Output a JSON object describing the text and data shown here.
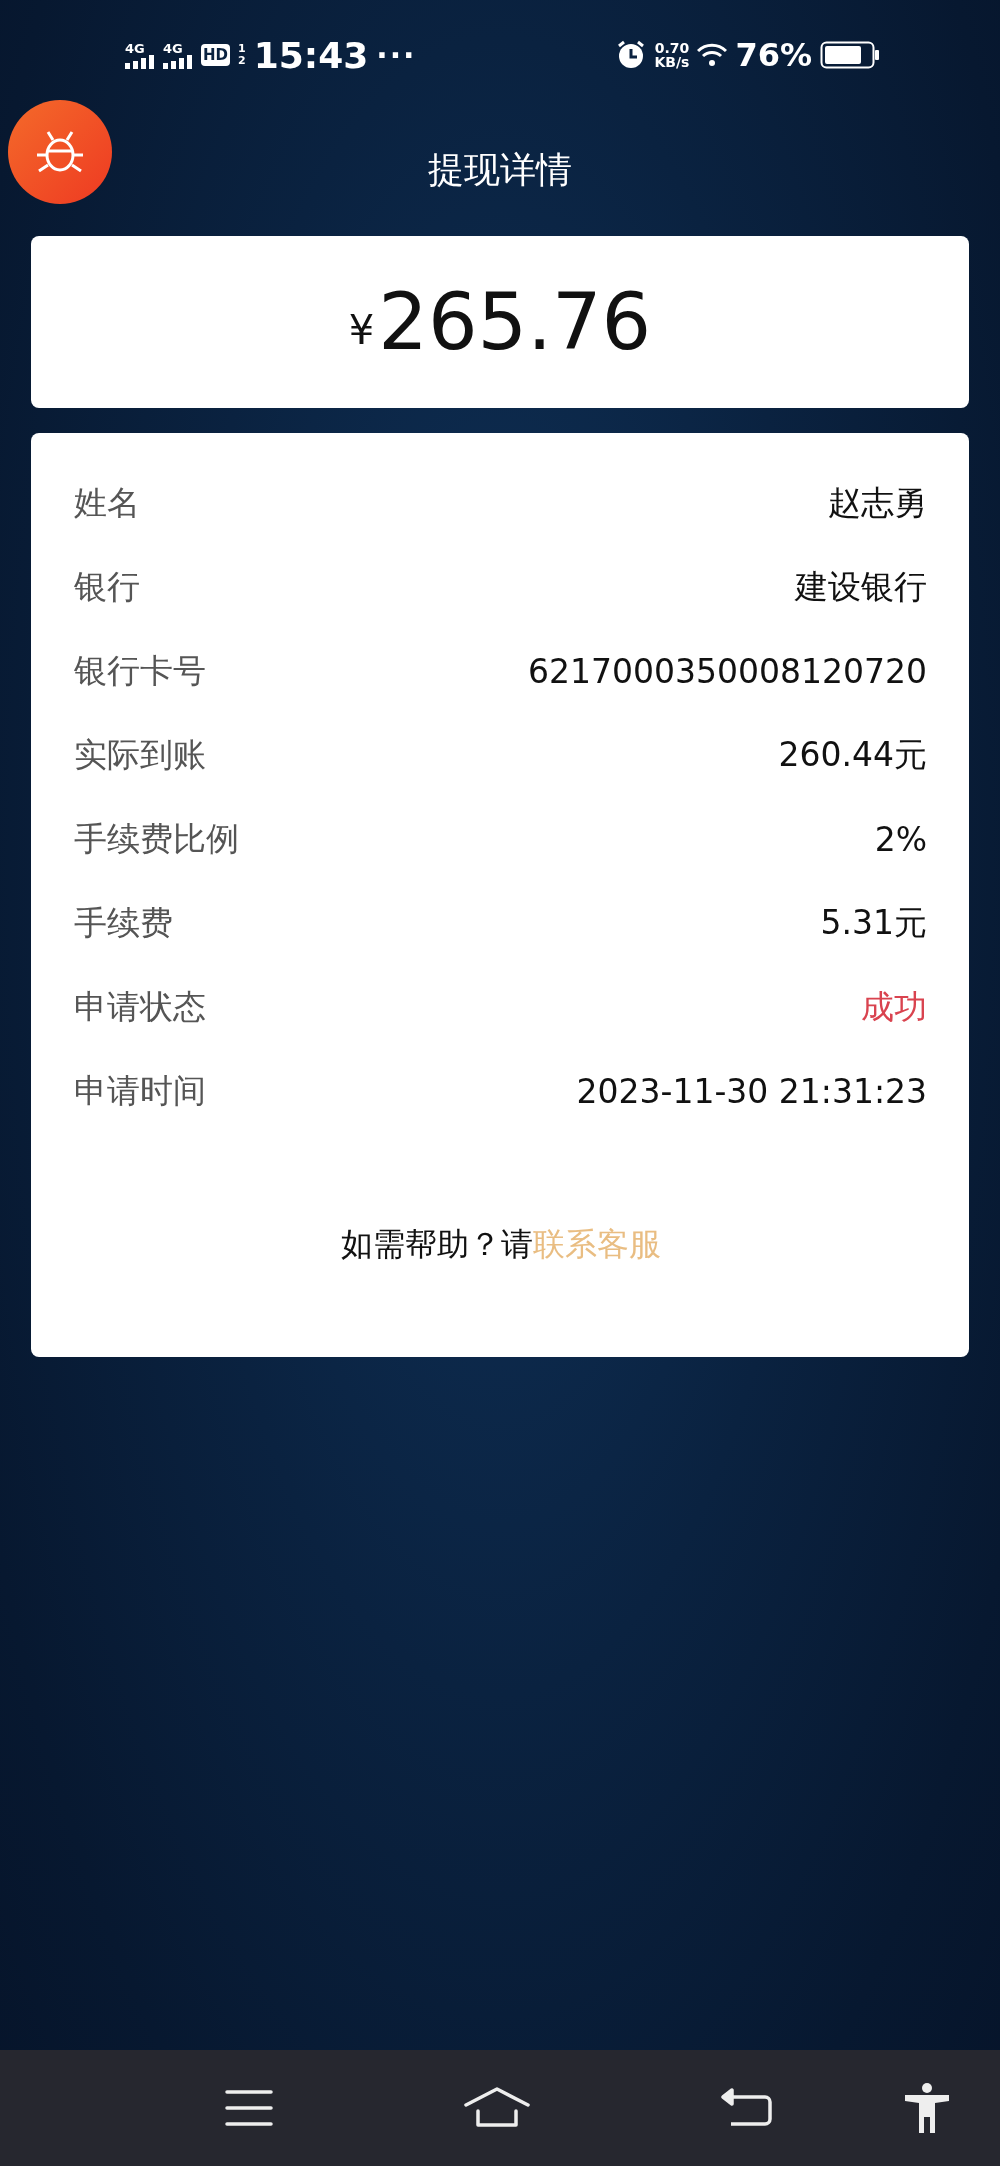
{
  "status_bar": {
    "network": [
      "4G",
      "4G"
    ],
    "hd": "HD",
    "hd_sims": [
      "1",
      "2"
    ],
    "time": "15:43",
    "more": "···",
    "speed": "0.70",
    "speed_unit": "KB/s",
    "battery": "76%"
  },
  "header": {
    "title": "提现详情"
  },
  "amount": {
    "currency": "¥",
    "value": "265.76"
  },
  "details": [
    {
      "label": "姓名",
      "value": "赵志勇",
      "kind": "plain"
    },
    {
      "label": "银行",
      "value": "建设银行",
      "kind": "plain"
    },
    {
      "label": "银行卡号",
      "value": "6217000350008120720",
      "kind": "plain"
    },
    {
      "label": "实际到账",
      "value": "260.44元",
      "kind": "plain"
    },
    {
      "label": "手续费比例",
      "value": "2%",
      "kind": "plain"
    },
    {
      "label": "手续费",
      "value": "5.31元",
      "kind": "plain"
    },
    {
      "label": "申请状态",
      "value": "成功",
      "kind": "status"
    },
    {
      "label": "申请时间",
      "value": "2023-11-30 21:31:23",
      "kind": "plain"
    }
  ],
  "help": {
    "text": "如需帮助？请",
    "link": "联系客服"
  }
}
